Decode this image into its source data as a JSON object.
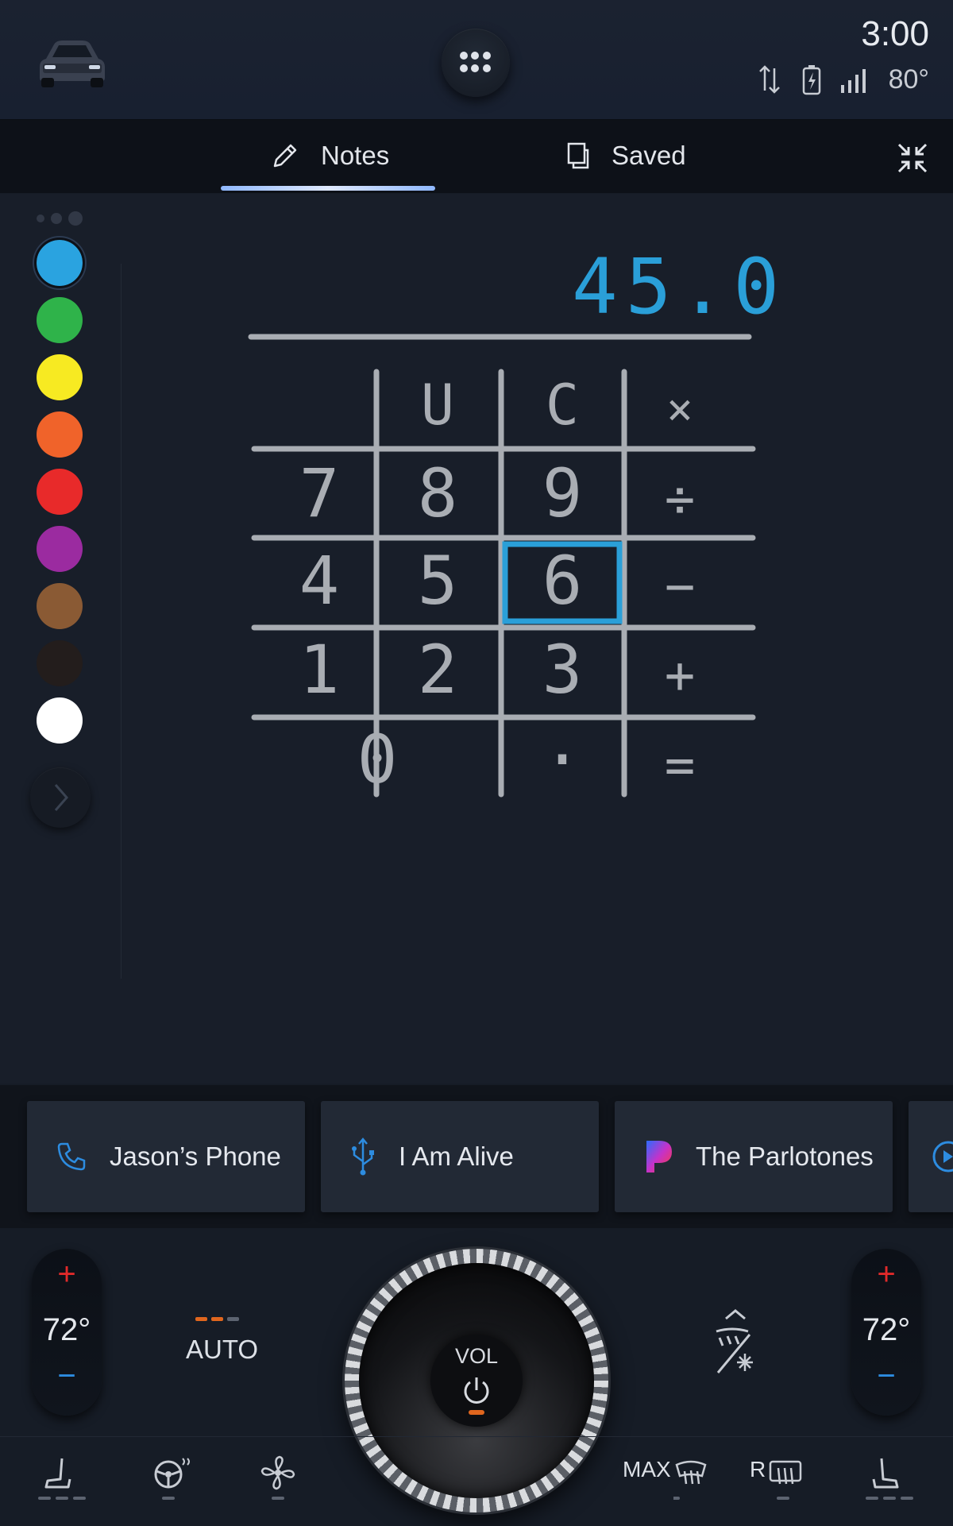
{
  "status_bar": {
    "time": "3:00",
    "outside_temp": "80°"
  },
  "tabs": [
    {
      "label": "Notes",
      "active": true
    },
    {
      "label": "Saved",
      "active": false
    }
  ],
  "palette": {
    "colors": [
      "#2aa3e0",
      "#2fb34a",
      "#f7ea22",
      "#f0632a",
      "#e82a2a",
      "#9b2ba0",
      "#8a5a34",
      "#231d1c",
      "#ffffff"
    ],
    "selected": 0
  },
  "calculator_drawing": {
    "result": "45.0",
    "rows": [
      [
        "",
        "U",
        "C",
        "×"
      ],
      [
        "7",
        "8",
        "9",
        "÷"
      ],
      [
        "4",
        "5",
        "6",
        "−"
      ],
      [
        "1",
        "2",
        "3",
        "+"
      ]
    ],
    "bottom_row": [
      "0",
      "·",
      "="
    ],
    "highlighted_key": "6",
    "highlight_color": "#2a9fd8"
  },
  "media_cards": [
    {
      "label": "Jason’s Phone",
      "icon": "phone-icon"
    },
    {
      "label": "I Am Alive",
      "icon": "usb-icon"
    },
    {
      "label": "The Parlotones",
      "icon": "pandora-icon"
    }
  ],
  "climate": {
    "left_temp": "72°",
    "right_temp": "72°",
    "plus": "+",
    "minus": "−",
    "auto_label": "AUTO",
    "volume_label": "VOL",
    "max_label": "MAX",
    "rear_label": "R"
  }
}
